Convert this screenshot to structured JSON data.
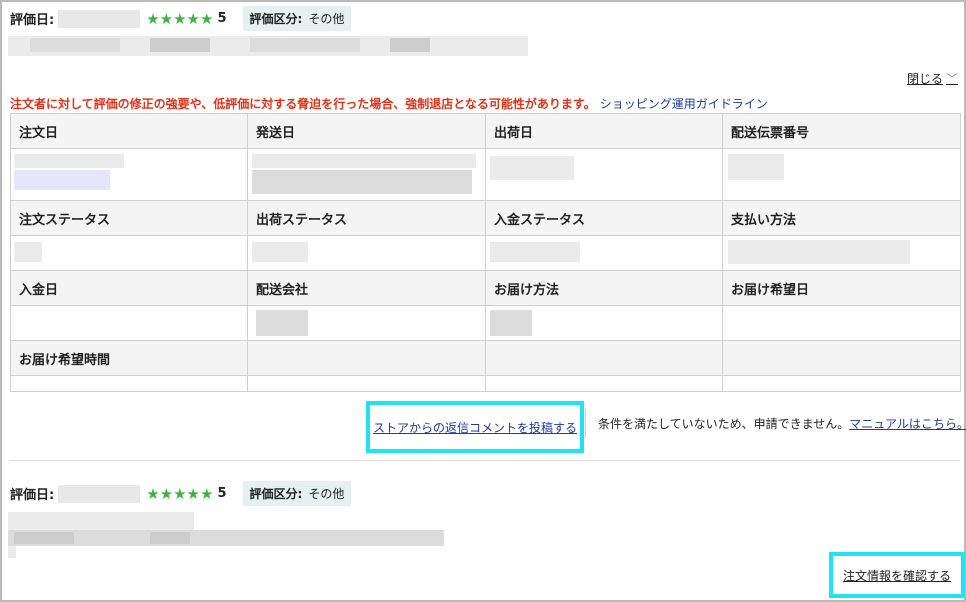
{
  "review1": {
    "date_label": "評価日:",
    "stars": "★★★★★",
    "score": "5",
    "category_label": "評価区分:",
    "category_value": "その他"
  },
  "close_link": "閉じる",
  "warning": {
    "text": "注文者に対して評価の修正の強要や、低評価に対する脅迫を行った場合、強制退店となる可能性があります。",
    "guideline_link": "ショッピング運用ガイドライン"
  },
  "table_headers": {
    "row1": [
      "注文日",
      "発送日",
      "出荷日",
      "配送伝票番号"
    ],
    "row2": [
      "注文ステータス",
      "出荷ステータス",
      "入金ステータス",
      "支払い方法"
    ],
    "row3": [
      "入金日",
      "配送会社",
      "お届け方法",
      "お届け希望日"
    ],
    "row4": [
      "お届け希望時間",
      "",
      "",
      ""
    ]
  },
  "actions": {
    "reply_link": "ストアからの返信コメントを投稿する",
    "condition_text": "条件を満たしていないため、申請できません。",
    "manual_link": "マニュアルはこちら。"
  },
  "review2": {
    "date_label": "評価日:",
    "stars": "★★★★★",
    "score": "5",
    "category_label": "評価区分:",
    "category_value": "その他"
  },
  "order_link": "注文情報を確認する",
  "colors": {
    "accent_highlight": "#1fe2f2",
    "star_green": "#3fb33f",
    "warning_red": "#e0331a",
    "link_blue": "#1c3aa8"
  },
  "icons": {
    "close_chevron": "chevron-down-icon",
    "order_chevron": "chevron-right-icon"
  }
}
